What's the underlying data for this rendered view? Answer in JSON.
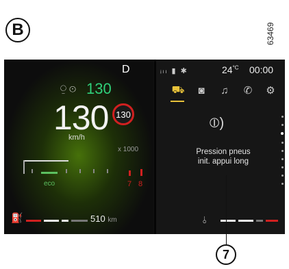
{
  "figure": {
    "label": "B",
    "ref_code": "63469",
    "callout": "7"
  },
  "cluster": {
    "gear": "D",
    "cruise_speed": "130",
    "cruise_icon": "cruise-control-icon",
    "speed": "130",
    "speed_unit": "km/h",
    "speed_limit": "130",
    "rpm_multiplier": "x 1000",
    "rpm_labels": [
      "7",
      "8"
    ],
    "eco_label": "eco",
    "fuel_range": "510",
    "fuel_range_unit": "km",
    "colors": {
      "cruise": "#2fd07a",
      "eco": "#5cc060",
      "warning": "#d02020",
      "active_tab": "#e8c23a"
    }
  },
  "right_panel": {
    "status_icons": [
      "signal-icon",
      "battery-icon",
      "bluetooth-icon"
    ],
    "temperature": "24",
    "temperature_unit": "°C",
    "clock": "00:00",
    "tabs": [
      {
        "name": "car-icon",
        "active": true
      },
      {
        "name": "camera-icon",
        "active": false
      },
      {
        "name": "music-icon",
        "active": false
      },
      {
        "name": "phone-icon",
        "active": false
      },
      {
        "name": "settings-icon",
        "active": false
      }
    ],
    "tpms_icon": "tyre-pressure-icon",
    "message_line1": "Pression pneus",
    "message_line2": "init. appui long"
  }
}
